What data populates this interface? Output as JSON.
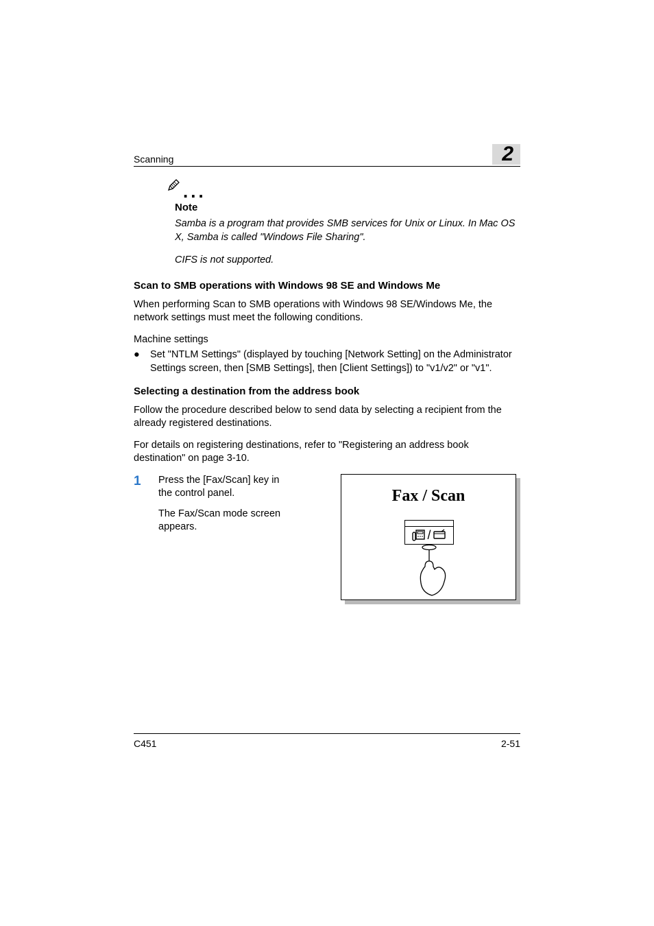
{
  "header": {
    "section": "Scanning",
    "chapter": "2"
  },
  "note": {
    "title": "Note",
    "body1": "Samba is a program that provides SMB services for Unix or Linux. In Mac OS X, Samba is called \"Windows File Sharing\".",
    "body2": "CIFS is not supported."
  },
  "sec1": {
    "heading": "Scan to SMB operations with Windows 98 SE and Windows Me",
    "para1": "When performing Scan to SMB operations with Windows 98 SE/Windows Me, the network settings must meet the following conditions.",
    "label": "Machine settings",
    "bullet1": "Set \"NTLM Settings\" (displayed by touching [Network Setting] on the Administrator Settings screen, then [SMB Settings], then [Client Settings]) to \"v1/v2\" or \"v1\"."
  },
  "sec2": {
    "heading": "Selecting a destination from the address book",
    "para1": "Follow the procedure described below to send data by selecting a recipient from the already registered destinations.",
    "para2": "For details on registering destinations, refer to \"Registering an address book destination\" on page 3-10."
  },
  "step1": {
    "number": "1",
    "text1": "Press the [Fax/Scan] key in the control panel.",
    "text2": "The Fax/Scan mode screen appears."
  },
  "figure": {
    "title": "Fax / Scan"
  },
  "footer": {
    "model": "C451",
    "page": "2-51"
  }
}
